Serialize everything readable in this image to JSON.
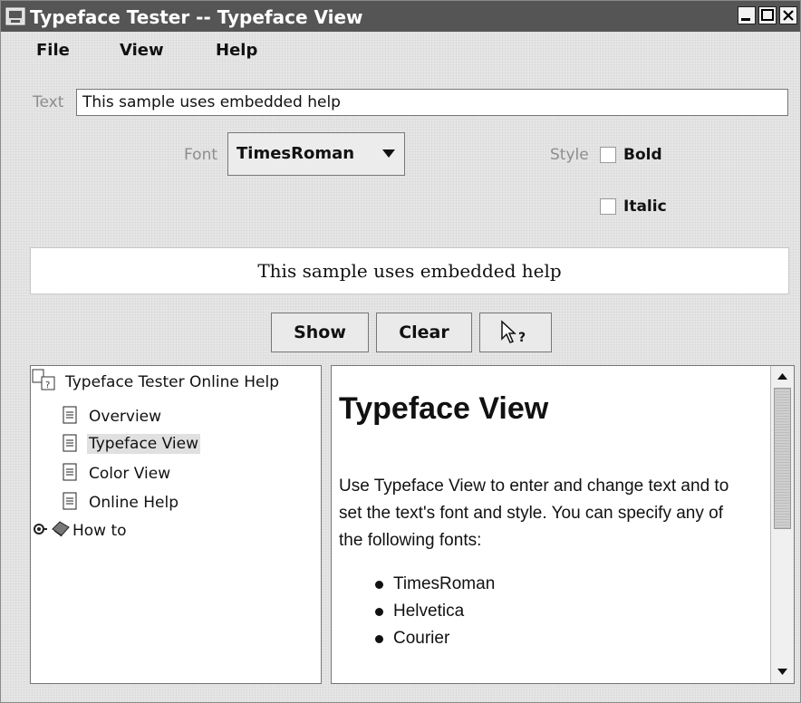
{
  "window": {
    "title": "Typeface Tester -- Typeface View"
  },
  "menubar": {
    "items": [
      "File",
      "View",
      "Help"
    ]
  },
  "text_row": {
    "label": "Text",
    "value": "This sample uses embedded help"
  },
  "font_row": {
    "label": "Font",
    "selected": "TimesRoman"
  },
  "style": {
    "label": "Style",
    "bold": "Bold",
    "italic": "Italic",
    "bold_checked": false,
    "italic_checked": false
  },
  "preview": {
    "text": "This sample uses embedded help"
  },
  "buttons": {
    "show": "Show",
    "clear": "Clear",
    "context_help": "?"
  },
  "help_tree": {
    "root": "Typeface Tester Online Help",
    "items": [
      "Overview",
      "Typeface View",
      "Color View",
      "Online Help"
    ],
    "selected": "Typeface View",
    "folder": "How to"
  },
  "help_content": {
    "heading": "Typeface View",
    "paragraph": "Use Typeface View to enter and change text and to set the text's font and style. You can specify any of the following fonts:",
    "fonts": [
      "TimesRoman",
      "Helvetica",
      "Courier"
    ]
  }
}
